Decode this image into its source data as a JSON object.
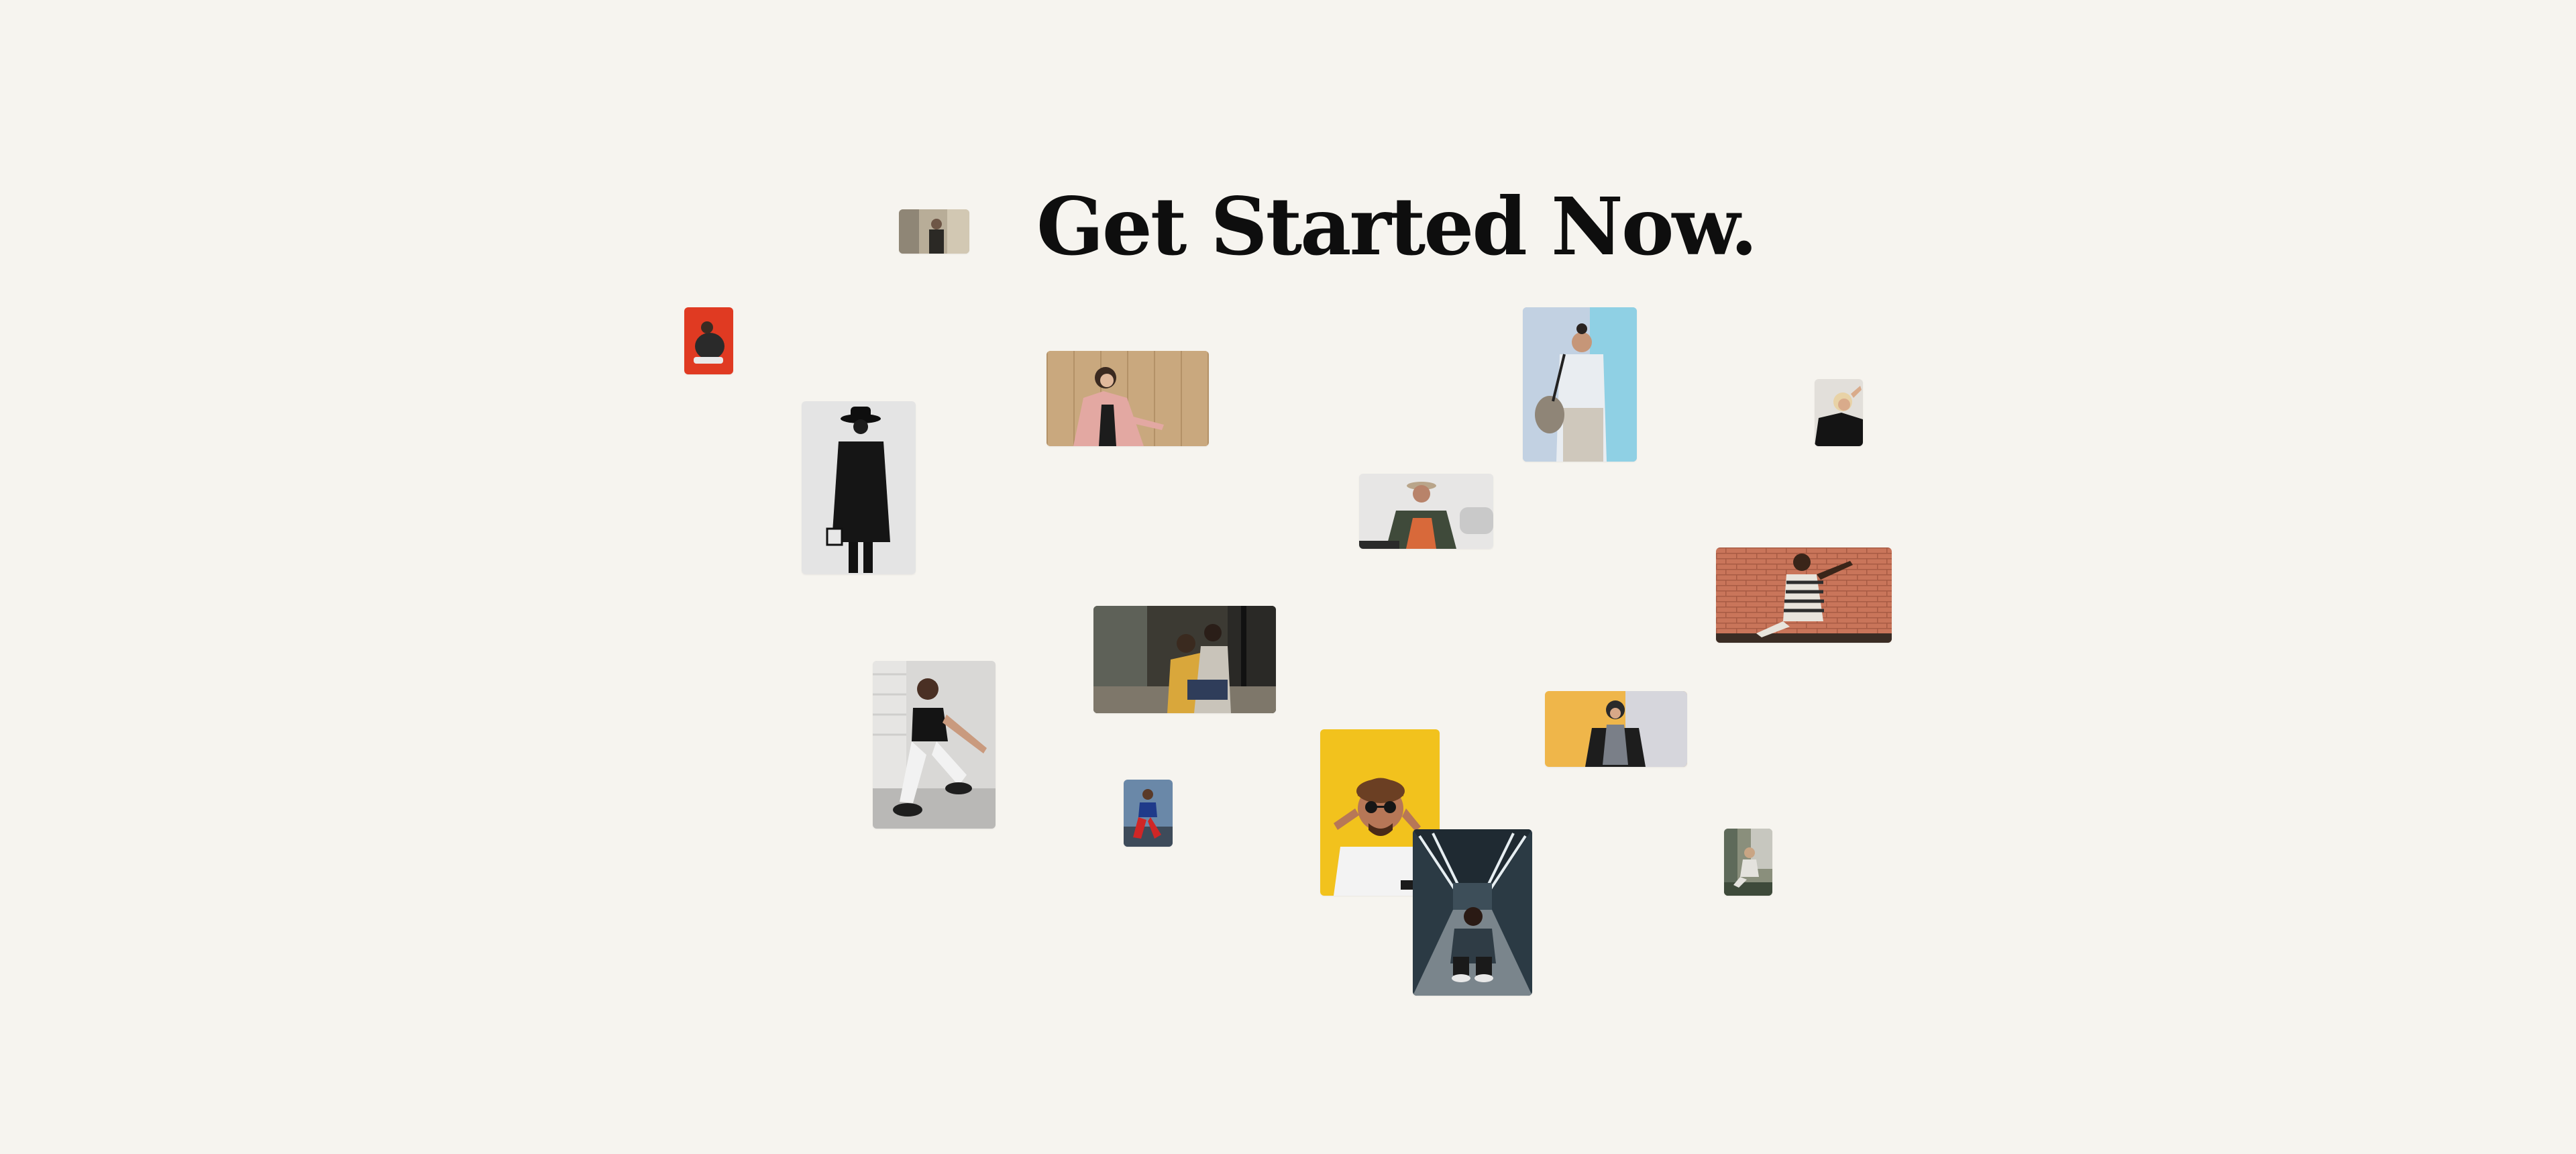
{
  "hero": {
    "title": "Get Started Now."
  },
  "photos": [
    {
      "name": "photo-man-street-wide",
      "background": "#b8ad98"
    },
    {
      "name": "photo-crouching-red-background",
      "background": "#e03a22"
    },
    {
      "name": "photo-woman-pink-coat",
      "background": "#c8a77c"
    },
    {
      "name": "photo-man-blue-wall",
      "background": "#a9c4de"
    },
    {
      "name": "photo-woman-blonde-dark",
      "background": "#d9d6d0"
    },
    {
      "name": "photo-man-black-hat-coat",
      "background": "#e4e4e4"
    },
    {
      "name": "photo-person-hat-sitting",
      "background": "#e7e6e5"
    },
    {
      "name": "photo-man-brick-wall",
      "background": "#c9755a"
    },
    {
      "name": "photo-couple-street",
      "background": "#3c3a33"
    },
    {
      "name": "photo-woman-crouching-sneakers",
      "background": "#d9d8d6"
    },
    {
      "name": "photo-woman-yellow-wall-headscarf",
      "background": "#efb64a"
    },
    {
      "name": "photo-person-red-pants-small",
      "background": "#5b7896"
    },
    {
      "name": "photo-man-yellow-sunglasses",
      "background": "#f2c21d"
    },
    {
      "name": "photo-man-subway-crouching",
      "background": "#2b3a44"
    },
    {
      "name": "photo-woman-sitting-small",
      "background": "#8a8f7c"
    }
  ]
}
